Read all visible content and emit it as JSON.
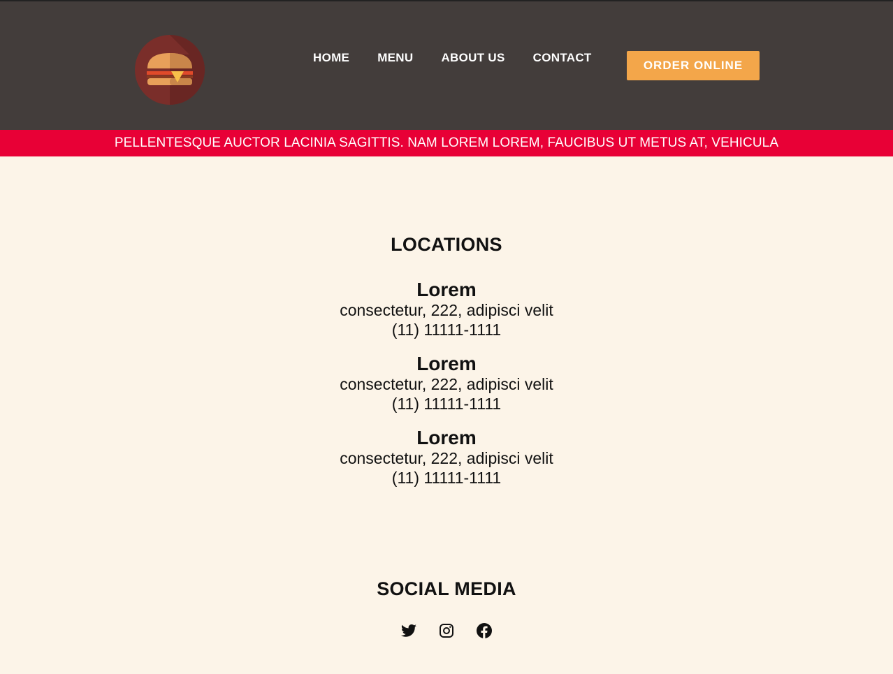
{
  "header": {
    "logo_icon": "burger-logo-icon",
    "nav": [
      {
        "label": "HOME"
      },
      {
        "label": "MENU"
      },
      {
        "label": "ABOUT US"
      },
      {
        "label": "CONTACT"
      }
    ],
    "order_button": "ORDER ONLINE"
  },
  "banner": {
    "text": "PELLENTESQUE AUCTOR LACINIA SAGITTIS. NAM LOREM LOREM, FAUCIBUS UT METUS AT, VEHICULA"
  },
  "locations": {
    "title": "LOCATIONS",
    "items": [
      {
        "name": "Lorem",
        "address": "consectetur, 222, adipisci velit",
        "phone": "(11) 11111-1111"
      },
      {
        "name": "Lorem",
        "address": "consectetur, 222, adipisci velit",
        "phone": "(11) 11111-1111"
      },
      {
        "name": "Lorem",
        "address": "consectetur, 222, adipisci velit",
        "phone": "(11) 11111-1111"
      }
    ]
  },
  "social": {
    "title": "SOCIAL MEDIA",
    "icons": [
      "twitter-icon",
      "instagram-icon",
      "facebook-icon"
    ]
  },
  "colors": {
    "header_bg": "#433d3b",
    "banner_bg": "#e80036",
    "accent": "#f3a64a",
    "page_bg": "#fcf4e8"
  }
}
